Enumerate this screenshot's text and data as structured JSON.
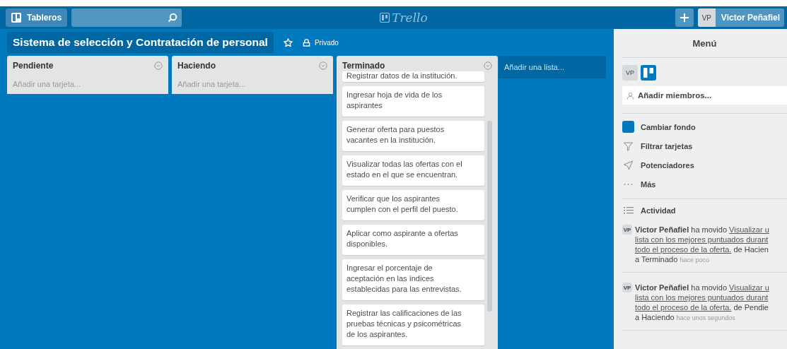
{
  "header": {
    "boards_button": "Tableros",
    "logo": "Trello",
    "user": {
      "initials": "VP",
      "name": "Victor Peñafiel"
    }
  },
  "board": {
    "title": "Sistema de selección y Contratación de personal",
    "starred": false,
    "visibility": "Privado"
  },
  "lists": [
    {
      "title": "Pendiente",
      "add_card": "Añadir una tarjeta..."
    },
    {
      "title": "Haciendo",
      "add_card": "Añadir una tarjeta..."
    },
    {
      "title": "Terminado",
      "cards": [
        "Registrar datos de la institución.",
        "Ingresar hoja de vida de los aspirantes",
        "Generar oferta para puestos vacantes en la institución.",
        "Visualizar todas las ofertas con el estado en el que se encuentran.",
        "Verificar que los aspirantes cumplen con el perfil del puesto.",
        "Aplicar como aspirante a ofertas disponibles.",
        "Ingresar el porcentaje de aceptación en las índices establecidas para las entrevistas.",
        "Registrar las calificaciones de las pruebas técnicas y psicométricas de los aspirantes."
      ]
    }
  ],
  "add_list": "Añadir una lista...",
  "menu": {
    "title": "Menú",
    "member_initials": "VP",
    "add_members": "Añadir miembros...",
    "items": [
      {
        "kind": "background",
        "label": "Cambiar fondo",
        "color": "#0079bf"
      },
      {
        "kind": "filter",
        "label": "Filtrar tarjetas"
      },
      {
        "kind": "powerups",
        "label": "Potenciadores"
      },
      {
        "kind": "more",
        "label": "Más"
      }
    ],
    "activity_title": "Actividad",
    "activities": [
      {
        "initials": "VP",
        "author": "Victor Peñafiel",
        "action": "ha movido",
        "card_lines": [
          "Visualizar u",
          "lista con los mejores puntuados durant",
          "todo el proceso de la oferta."
        ],
        "from": "de Hacien",
        "to": "a Terminado",
        "time": "hace poco"
      },
      {
        "initials": "VP",
        "author": "Victor Peñafiel",
        "action": "ha movido",
        "card_lines": [
          "Visualizar u",
          "lista con los mejores puntuados durant",
          "todo el proceso de la oferta."
        ],
        "from": "de Pendie",
        "to": "a Haciendo",
        "time": "hace unos segundos"
      }
    ]
  }
}
